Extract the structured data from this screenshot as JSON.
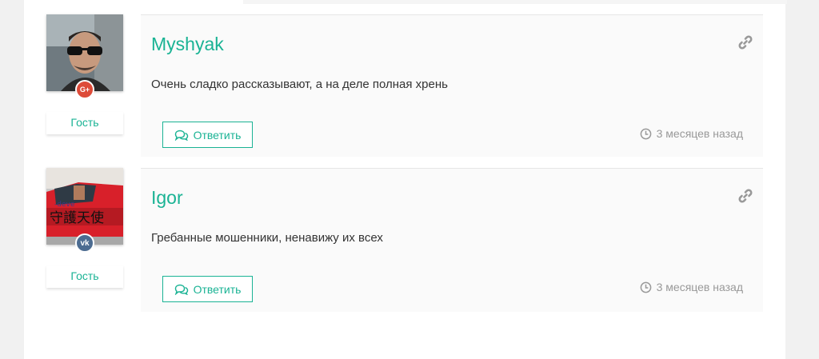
{
  "comments": [
    {
      "author": "Myshyak",
      "text": "Очень сладко рассказывают, а на деле полная хрень",
      "role": "Гость",
      "social": "G+",
      "social_network": "google-plus",
      "reply_label": "Ответить",
      "time": "3 месяцев назад"
    },
    {
      "author": "Igor",
      "text": "Гребанные мошенники, ненавижу их всех",
      "role": "Гость",
      "social": "vk",
      "social_network": "vkontakte",
      "reply_label": "Ответить",
      "time": "3 месяцев назад"
    }
  ],
  "colors": {
    "accent": "#1ab394",
    "google": "#dd4b39",
    "vk": "#4c6c91",
    "muted": "#999999"
  }
}
